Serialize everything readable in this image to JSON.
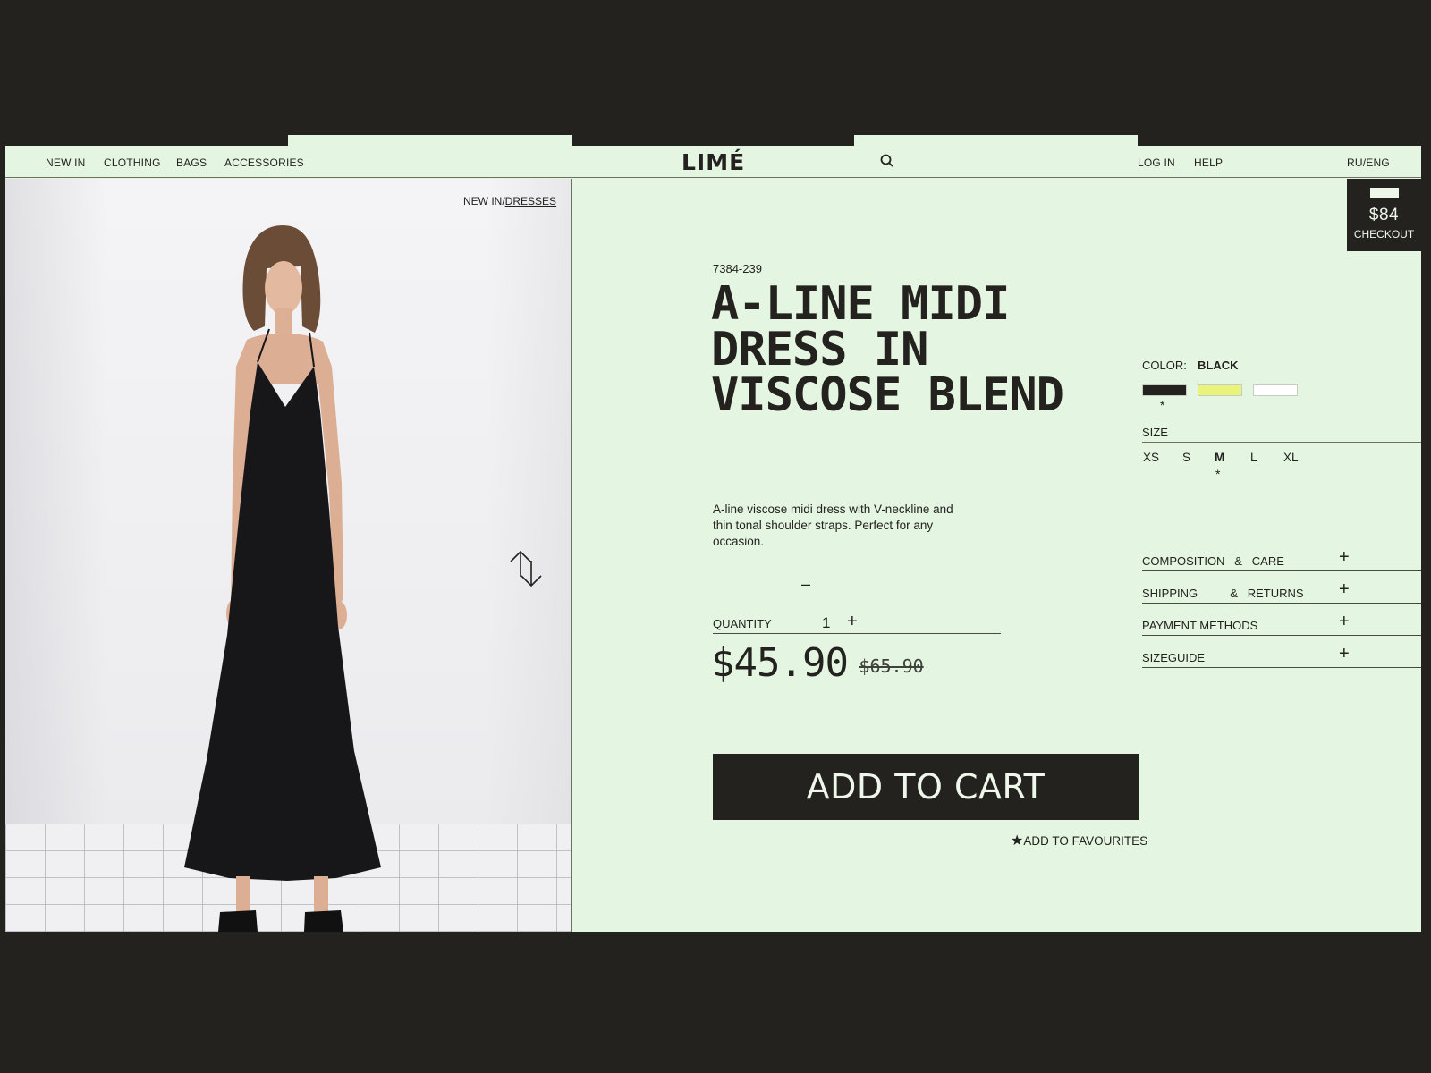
{
  "nav": {
    "items": [
      "NEW IN",
      "CLOTHING",
      "BAGS",
      "ACCESSORIES"
    ],
    "logo": "LIMÉ",
    "right_items": [
      "LOG IN",
      "HELP"
    ],
    "language": "RU/ENG"
  },
  "breadcrumb": {
    "parent": "NEW IN/",
    "current": "DRESSES"
  },
  "product": {
    "sku": "7384-239",
    "title": "A-LINE MIDI DRESS IN VISCOSE BLEND",
    "description": "A-line viscose midi dress with V-neckline and thin tonal shoulder straps. Perfect for any occasion.",
    "quantity_label": "QUANTITY",
    "quantity": "1",
    "minus": "–",
    "plus": "+",
    "price": "$45.90",
    "old_price": "$65.90",
    "add_to_cart": "ADD TO CART",
    "favourites_star": "★",
    "favourites": "ADD TO FAVOURITES"
  },
  "checkout": {
    "amount": "$84",
    "label": "CHECKOUT"
  },
  "options": {
    "color_label": "COLOR:",
    "color_value": "BLACK",
    "swatches": [
      {
        "name": "black",
        "hex": "#23221e"
      },
      {
        "name": "yellow",
        "hex": "#e9f47a"
      },
      {
        "name": "white",
        "hex": "#ffffff"
      }
    ],
    "selected_marker": "*",
    "size_label": "SIZE",
    "sizes": [
      "XS",
      "S",
      "M",
      "L",
      "XL"
    ],
    "selected_size": "M"
  },
  "accordion": [
    {
      "label": "COMPOSITION   &   CARE"
    },
    {
      "label": "SHIPPING          &   RETURNS"
    },
    {
      "label": "PAYMENT METHODS"
    },
    {
      "label": "SIZEGUIDE"
    }
  ],
  "colors": {
    "background": "#23221e",
    "panel": "#e4f5e2",
    "ink": "#23221e"
  }
}
